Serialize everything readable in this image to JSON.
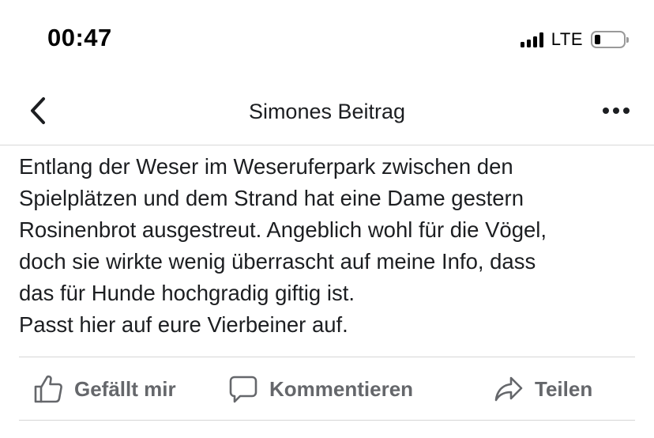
{
  "status_bar": {
    "time": "00:47",
    "network": "LTE",
    "signal_bars": 4,
    "battery_level": 0.22
  },
  "nav": {
    "title": "Simones Beitrag",
    "back_icon": "chevron-left-icon",
    "more_icon": "more-horizontal-icon"
  },
  "post": {
    "lines": [
      "Entlang der Weser im Weseruferpark zwischen den",
      "Spielplätzen und dem Strand hat eine Dame gestern",
      "Rosinenbrot ausgestreut. Angeblich wohl für die Vögel,",
      "doch sie wirkte wenig überrascht auf meine Info, dass",
      "das für Hunde hochgradig giftig ist.",
      "Passt hier auf eure Vierbeiner auf."
    ]
  },
  "actions": {
    "like": {
      "label": "Gefällt mir",
      "icon": "thumbs-up-icon"
    },
    "comment": {
      "label": "Kommentieren",
      "icon": "comment-icon"
    },
    "share": {
      "label": "Teilen",
      "icon": "share-arrow-icon"
    }
  },
  "colors": {
    "text": "#1c1e21",
    "action_gray": "#65676b",
    "divider": "#d6d6d6"
  }
}
